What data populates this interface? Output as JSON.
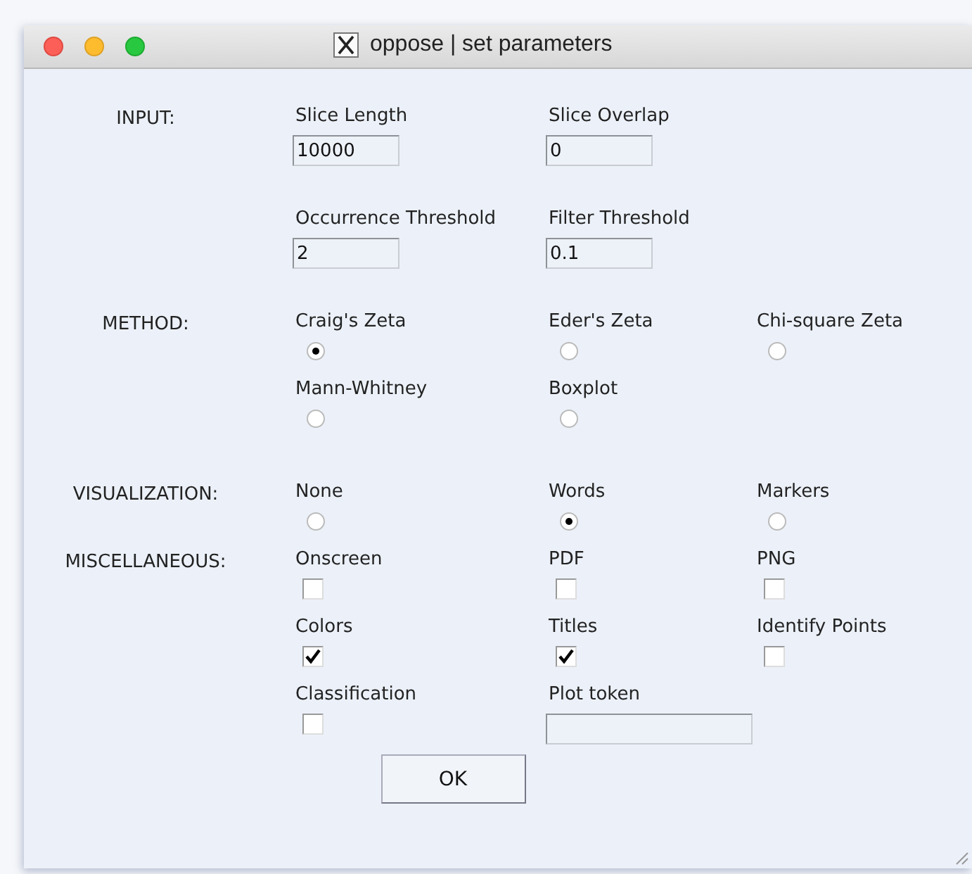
{
  "window": {
    "title": "oppose | set parameters"
  },
  "sections": [
    {
      "label": "INPUT:",
      "rows": [
        [
          {
            "kind": "field",
            "label": "Slice Length",
            "value": "10000"
          },
          {
            "kind": "field",
            "label": "Slice Overlap",
            "value": "0"
          }
        ],
        [
          {
            "kind": "field",
            "label": "Occurrence Threshold",
            "value": "2"
          },
          {
            "kind": "field",
            "label": "Filter Threshold",
            "value": "0.1"
          }
        ]
      ]
    },
    {
      "label": "METHOD:",
      "rows": [
        [
          {
            "kind": "radio",
            "label": "Craig's Zeta",
            "selected": true
          },
          {
            "kind": "radio",
            "label": "Eder's Zeta",
            "selected": false
          },
          {
            "kind": "radio",
            "label": "Chi-square Zeta",
            "selected": false
          }
        ],
        [
          {
            "kind": "radio",
            "label": "Mann-Whitney",
            "selected": false
          },
          {
            "kind": "radio",
            "label": "Boxplot",
            "selected": false
          }
        ]
      ]
    },
    {
      "label": "VISUALIZATION:",
      "rows": [
        [
          {
            "kind": "radio",
            "label": "None",
            "selected": false
          },
          {
            "kind": "radio",
            "label": "Words",
            "selected": true
          },
          {
            "kind": "radio",
            "label": "Markers",
            "selected": false
          }
        ]
      ]
    },
    {
      "label": "MISCELLANEOUS:",
      "rows": [
        [
          {
            "kind": "checkbox",
            "label": "Onscreen",
            "checked": false
          },
          {
            "kind": "checkbox",
            "label": "PDF",
            "checked": false
          },
          {
            "kind": "checkbox",
            "label": "PNG",
            "checked": false
          }
        ],
        [
          {
            "kind": "checkbox",
            "label": "Colors",
            "checked": true
          },
          {
            "kind": "checkbox",
            "label": "Titles",
            "checked": true
          },
          {
            "kind": "checkbox",
            "label": "Identify Points",
            "checked": false
          }
        ],
        [
          {
            "kind": "checkbox",
            "label": "Classification",
            "checked": false
          },
          {
            "kind": "wide-field",
            "label": "Plot token"
          }
        ]
      ]
    }
  ],
  "ok_button": "OK"
}
